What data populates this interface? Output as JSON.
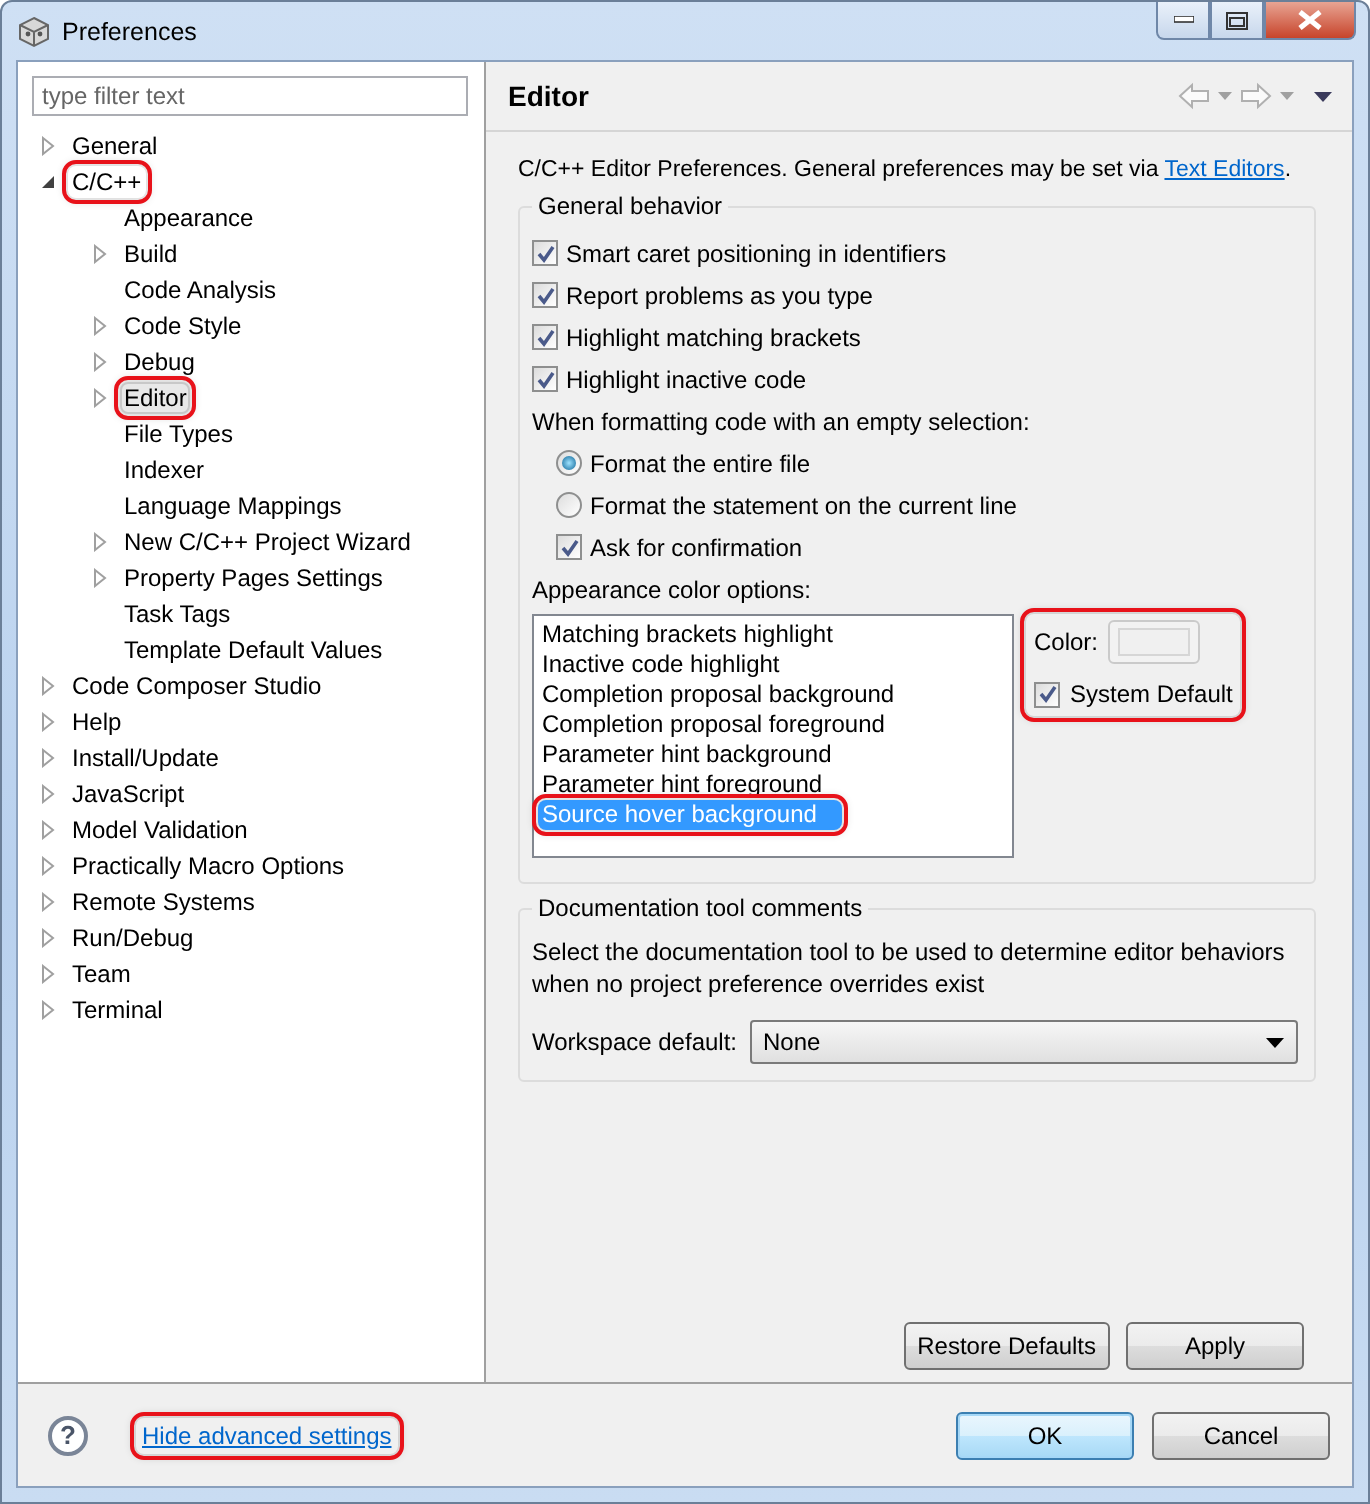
{
  "window": {
    "title": "Preferences"
  },
  "filter": {
    "placeholder": "type filter text"
  },
  "tree": [
    {
      "label": "General",
      "expanded": false,
      "selected": false,
      "callout": false
    },
    {
      "label": "C/C++",
      "expanded": true,
      "selected": false,
      "callout": true,
      "children": [
        {
          "label": "Appearance",
          "selected": false,
          "callout": false
        },
        {
          "label": "Build",
          "expanded": false,
          "selected": false,
          "callout": false
        },
        {
          "label": "Code Analysis",
          "selected": false,
          "callout": false
        },
        {
          "label": "Code Style",
          "expanded": false,
          "selected": false,
          "callout": false
        },
        {
          "label": "Debug",
          "expanded": false,
          "selected": false,
          "callout": false
        },
        {
          "label": "Editor",
          "expanded": false,
          "selected": true,
          "callout": true
        },
        {
          "label": "File Types",
          "selected": false,
          "callout": false
        },
        {
          "label": "Indexer",
          "selected": false,
          "callout": false
        },
        {
          "label": "Language Mappings",
          "selected": false,
          "callout": false
        },
        {
          "label": "New C/C++ Project Wizard",
          "expanded": false,
          "selected": false,
          "callout": false
        },
        {
          "label": "Property Pages Settings",
          "expanded": false,
          "selected": false,
          "callout": false
        },
        {
          "label": "Task Tags",
          "selected": false,
          "callout": false
        },
        {
          "label": "Template Default Values",
          "selected": false,
          "callout": false
        }
      ]
    },
    {
      "label": "Code Composer Studio",
      "expanded": false,
      "selected": false,
      "callout": false
    },
    {
      "label": "Help",
      "expanded": false,
      "selected": false,
      "callout": false
    },
    {
      "label": "Install/Update",
      "expanded": false,
      "selected": false,
      "callout": false
    },
    {
      "label": "JavaScript",
      "expanded": false,
      "selected": false,
      "callout": false
    },
    {
      "label": "Model Validation",
      "expanded": false,
      "selected": false,
      "callout": false
    },
    {
      "label": "Practically Macro Options",
      "expanded": false,
      "selected": false,
      "callout": false
    },
    {
      "label": "Remote Systems",
      "expanded": false,
      "selected": false,
      "callout": false
    },
    {
      "label": "Run/Debug",
      "expanded": false,
      "selected": false,
      "callout": false
    },
    {
      "label": "Team",
      "expanded": false,
      "selected": false,
      "callout": false
    },
    {
      "label": "Terminal",
      "expanded": false,
      "selected": false,
      "callout": false
    }
  ],
  "page": {
    "title": "Editor",
    "description": "C/C++ Editor Preferences. General preferences may be set via ",
    "link": "Text Editors",
    "description_end": "."
  },
  "general_behavior": {
    "title": "General behavior",
    "options": [
      {
        "kind": "checkbox",
        "label": "Smart caret positioning in identifiers",
        "checked": true
      },
      {
        "kind": "checkbox",
        "label": "Report problems as you type",
        "checked": true
      },
      {
        "kind": "checkbox",
        "label": "Highlight matching brackets",
        "checked": true
      },
      {
        "kind": "checkbox",
        "label": "Highlight inactive code",
        "checked": true
      },
      {
        "kind": "label",
        "label": "When formatting code with an empty selection:",
        "children": [
          {
            "kind": "radio",
            "label": "Format the entire file",
            "selected": true
          },
          {
            "kind": "radio",
            "label": "Format the statement on the current line",
            "selected": false
          },
          {
            "kind": "checkbox",
            "label": "Ask for confirmation",
            "checked": true
          }
        ]
      }
    ]
  },
  "appearance": {
    "label": "Appearance color options:",
    "items": [
      {
        "label": "Matching brackets highlight",
        "selected": false,
        "callout": false
      },
      {
        "label": "Inactive code highlight",
        "selected": false,
        "callout": false
      },
      {
        "label": "Completion proposal background",
        "selected": false,
        "callout": false
      },
      {
        "label": "Completion proposal foreground",
        "selected": false,
        "callout": false
      },
      {
        "label": "Parameter hint background",
        "selected": false,
        "callout": false
      },
      {
        "label": "Parameter hint foreground",
        "selected": false,
        "callout": false
      },
      {
        "label": "Source hover background",
        "selected": true,
        "callout": true
      }
    ],
    "color_panel": {
      "label": "Color:",
      "disabled": true,
      "callout": true,
      "system_default": {
        "label": "System Default",
        "checked": true
      }
    }
  },
  "documentation": {
    "title": "Documentation tool comments",
    "description": "Select the documentation tool to be used to determine editor behaviors when no project preference overrides exist",
    "field_label": "Workspace default:",
    "value": "None"
  },
  "page_buttons": [
    "Restore Defaults",
    "Apply"
  ],
  "footer": {
    "help_glyph": "?",
    "link": "Hide advanced settings",
    "link_callout": true,
    "buttons": [
      {
        "label": "OK",
        "default": true
      },
      {
        "label": "Cancel",
        "default": false
      }
    ]
  }
}
